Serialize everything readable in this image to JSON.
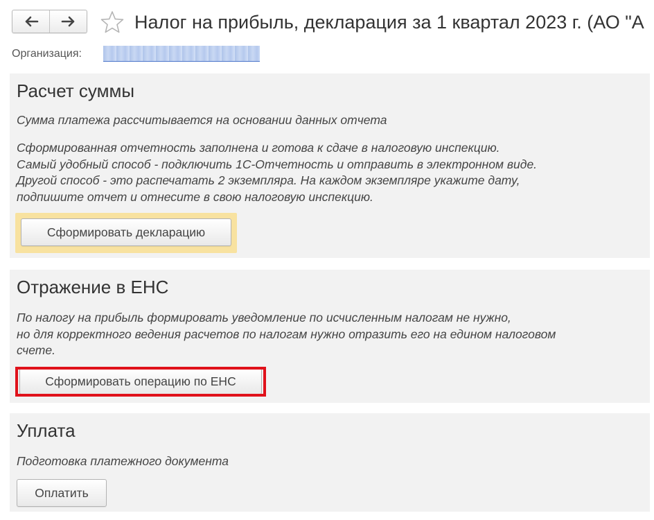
{
  "header": {
    "title": "Налог на прибыль, декларация за 1 квартал 2023 г. (АО \"А",
    "back_icon": "arrow-left-icon",
    "forward_icon": "arrow-right-icon",
    "favorite_icon": "star-outline-icon"
  },
  "organization": {
    "label": "Организация:"
  },
  "sections": {
    "calc": {
      "title": "Расчет суммы",
      "subtitle": "Сумма платежа рассчитывается на основании данных отчета",
      "lines": [
        "Сформированная отчетность заполнена и готова к сдаче в налоговую инспекцию.",
        "Самый удобный способ - подключить 1С-Отчетность и отправить в электронном виде.",
        "Другой способ - это распечатать 2 экземпляра. На каждом экземпляре укажите дату,",
        "подпишите отчет и отнесите в свою налоговую инспекцию."
      ],
      "button": "Сформировать декларацию"
    },
    "ens": {
      "title": "Отражение в ЕНС",
      "lines": [
        "По налогу на прибыль формировать уведомление по исчисленным налогам не нужно,",
        "но для корректного ведения расчетов по налогам нужно отразить его на едином налоговом",
        "счете."
      ],
      "button": "Сформировать операцию по ЕНС"
    },
    "pay": {
      "title": "Уплата",
      "subtitle": "Подготовка платежного документа",
      "button": "Оплатить"
    }
  },
  "colors": {
    "section_bg": "#f2f2f2",
    "highlight_yellow": "#f8e2a0",
    "highlight_red": "#e0121b"
  }
}
